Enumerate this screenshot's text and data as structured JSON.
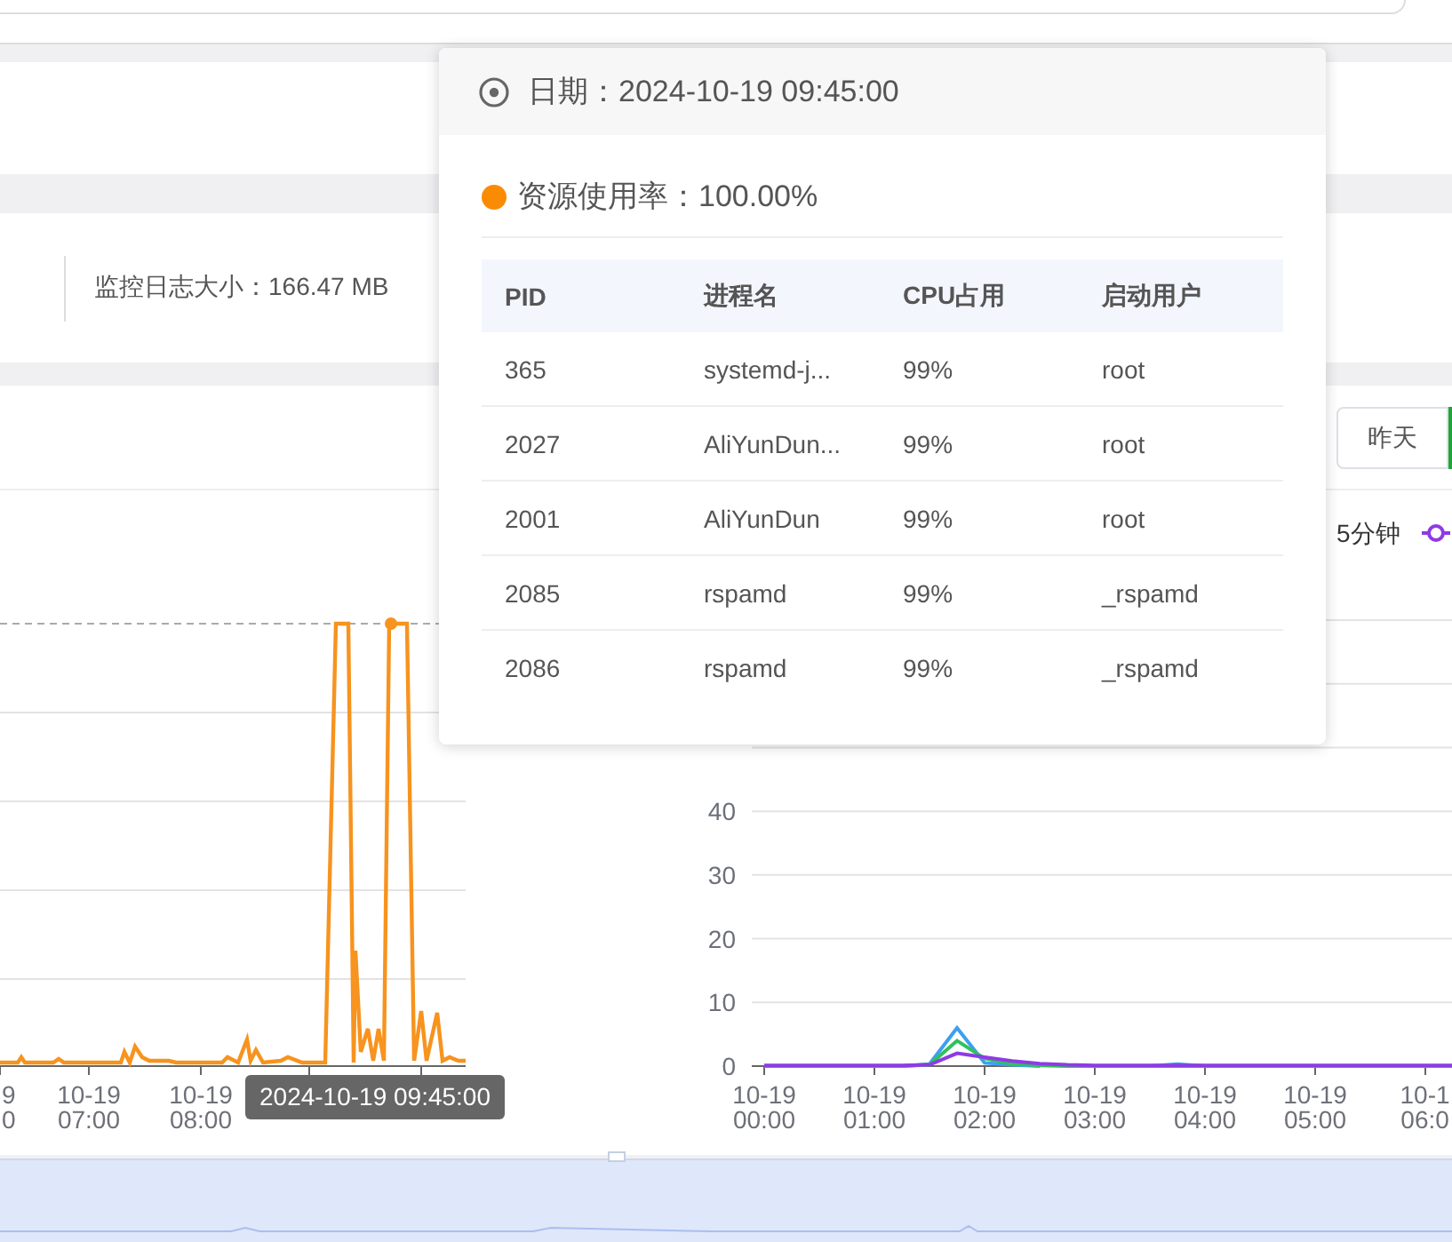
{
  "summary": {
    "log_size": "监控日志大小：166.47 MB"
  },
  "range_buttons": [
    {
      "label": "昨天",
      "selected": false
    },
    {
      "selected": true
    }
  ],
  "left_chart": {
    "x_labels": [
      {
        "lines": [
          "9",
          "0"
        ]
      },
      {
        "lines": [
          "10-19",
          "07:00"
        ]
      },
      {
        "lines": [
          "10-19",
          "08:00"
        ]
      }
    ],
    "pointer_label": "2024-10-19 09:45:00"
  },
  "right_chart": {
    "chart_data": {
      "type": "line",
      "categories": [
        "10-19 00:00",
        null,
        null,
        null,
        "10-19 01:00",
        null,
        null,
        null,
        "10-19 02:00",
        null,
        null,
        null,
        "10-19 03:00",
        null,
        null,
        null,
        "10-19 04:00",
        null,
        null,
        null,
        "10-19 05:00",
        null,
        null,
        null,
        "10-1 06:0",
        null
      ],
      "ylim": [
        0,
        70
      ],
      "grid": true,
      "yticks": [
        0,
        10,
        20,
        30,
        40
      ],
      "series": [
        {
          "color": "#3ba0f0",
          "values": [
            null,
            null,
            null,
            null,
            null,
            0,
            0.3,
            6,
            0.5,
            0.2,
            0,
            null,
            null,
            null,
            0,
            0.3,
            0,
            null,
            null,
            null,
            null,
            null,
            null,
            null,
            null,
            null
          ]
        },
        {
          "name": "5分钟",
          "color": "#2fc25b",
          "values": [
            0,
            0,
            0,
            0,
            0,
            0,
            0.2,
            4,
            1.2,
            0.4,
            0.1,
            0,
            0,
            0,
            0,
            0,
            0,
            0,
            0,
            0,
            0,
            0,
            0,
            0,
            0,
            0
          ]
        },
        {
          "color": "#8e3be6",
          "values": [
            0.1,
            0.1,
            0.1,
            0.1,
            0.1,
            0.1,
            0.2,
            2,
            1.4,
            0.8,
            0.4,
            0.2,
            0.1,
            0.1,
            0.1,
            0.1,
            0.1,
            0.1,
            0.1,
            0.1,
            0.1,
            0.1,
            0.1,
            0.1,
            0.1,
            0.1
          ]
        }
      ]
    }
  },
  "tooltip": {
    "title": "日期：2024-10-19 09:45:00",
    "metric": "资源使用率：100.00%",
    "columns": [
      "PID",
      "进程名",
      "CPU占用",
      "启动用户"
    ],
    "rows": [
      [
        "365",
        "systemd-j...",
        "99%",
        "root"
      ],
      [
        "2027",
        "AliYunDun...",
        "99%",
        "root"
      ],
      [
        "2001",
        "AliYunDun",
        "99%",
        "root"
      ],
      [
        "2085",
        "rspamd",
        "99%",
        "_rspamd"
      ],
      [
        "2086",
        "rspamd",
        "99%",
        "_rspamd"
      ]
    ]
  },
  "zoom_slider": {
    "level": 1
  }
}
